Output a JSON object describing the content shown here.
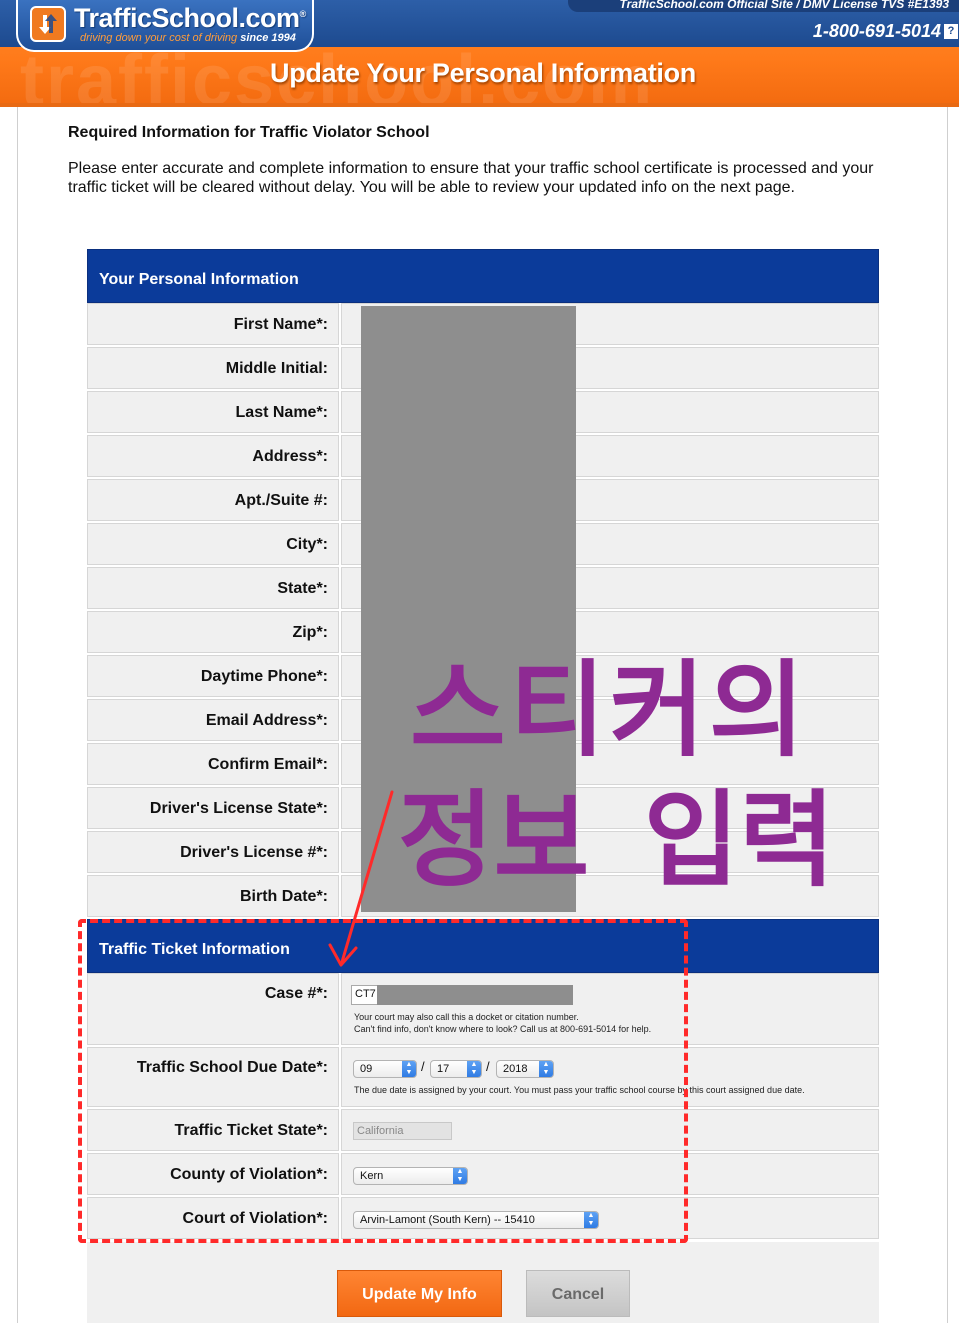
{
  "header": {
    "logo_text": "TrafficSchool.com",
    "logo_reg": "®",
    "tagline": "driving down your cost of driving",
    "tagline_since": "since 1994",
    "official_text": "TrafficSchool.com Official Site / DMV License TVS #E1393",
    "phone": "1-800-691-5014",
    "help_icon_label": "?",
    "banner_title": "Update Your Personal Information",
    "watermark": "trafficschool.com"
  },
  "intro": {
    "title": "Required Information for Traffic Violator School",
    "text": "Please enter accurate and complete information to ensure that your traffic school certificate is processed and your traffic ticket will be cleared without delay. You will be able to review your updated info on the next page."
  },
  "personal": {
    "heading": "Your Personal Information",
    "labels": [
      "First Name*:",
      "Middle Initial:",
      "Last Name*:",
      "Address*:",
      "Apt./Suite #:",
      "City*:",
      "State*:",
      "Zip*:",
      "Daytime Phone*:",
      "Email Address*:",
      "Confirm Email*:",
      "Driver's License State*:",
      "Driver's License #*:",
      "Birth Date*:"
    ]
  },
  "ticket": {
    "heading": "Traffic Ticket Information",
    "case_label": "Case #*:",
    "case_value": "CT7",
    "case_note1": "Your court may also call this a docket or citation number.",
    "case_note2": "Can't find info, don't know where to look? Call us at 800-691-5014 for help.",
    "due_label": "Traffic School Due Date*:",
    "due_month": "09",
    "due_day": "17",
    "due_year": "2018",
    "date_sep": "/",
    "due_note": "The due date is assigned by your court. You must pass your traffic school course by this court assigned due date.",
    "state_label": "Traffic Ticket State*:",
    "state_value": "California",
    "county_label": "County of Violation*:",
    "county_value": "Kern",
    "court_label": "Court of Violation*:",
    "court_value": "Arvin-Lamont (South Kern) -- 15410"
  },
  "buttons": {
    "update": "Update My Info",
    "cancel": "Cancel"
  },
  "annotation": {
    "line1": "스티커의",
    "line2": "정보 입력",
    "color": "#8e2a93",
    "box_color": "#ff2a2a"
  },
  "colors": {
    "header_orange": "#ff7a1a",
    "header_blue": "#1d4a8f",
    "section_blue": "#0b3b9a",
    "button_orange": "#f26812"
  }
}
